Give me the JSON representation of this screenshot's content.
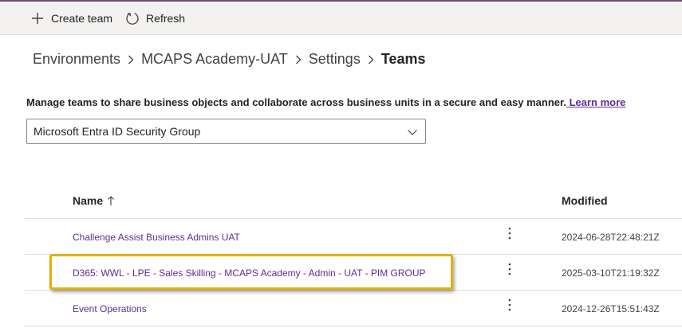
{
  "toolbar": {
    "create_team_label": "Create team",
    "refresh_label": "Refresh"
  },
  "breadcrumb": {
    "items": [
      "Environments",
      "MCAPS Academy-UAT",
      "Settings"
    ],
    "current": "Teams"
  },
  "description": {
    "text": "Manage teams to share business objects and collaborate across business units in a secure and easy manner.",
    "link_label": " Learn more"
  },
  "filter": {
    "selected": "Microsoft Entra ID Security Group"
  },
  "grid": {
    "columns": {
      "name": "Name",
      "modified": "Modified"
    },
    "rows": [
      {
        "name": "Challenge Assist Business Admins UAT",
        "modified": "2024-06-28T22:48:21Z"
      },
      {
        "name": "D365: WWL - LPE - Sales Skilling - MCAPS Academy - Admin - UAT - PIM GROUP",
        "modified": "2025-03-10T21:19:32Z"
      },
      {
        "name": "Event Operations",
        "modified": "2024-12-26T15:51:43Z"
      }
    ]
  },
  "colors": {
    "accent_link": "#5c2e91",
    "highlight": "#e3b100",
    "toolbar_bg": "#f3f2f1"
  },
  "icons": {
    "create": "plus-icon",
    "refresh": "refresh-icon",
    "sort": "arrow-up-icon",
    "row_menu": "more-vertical-icon",
    "dropdown": "chevron-down-icon"
  }
}
